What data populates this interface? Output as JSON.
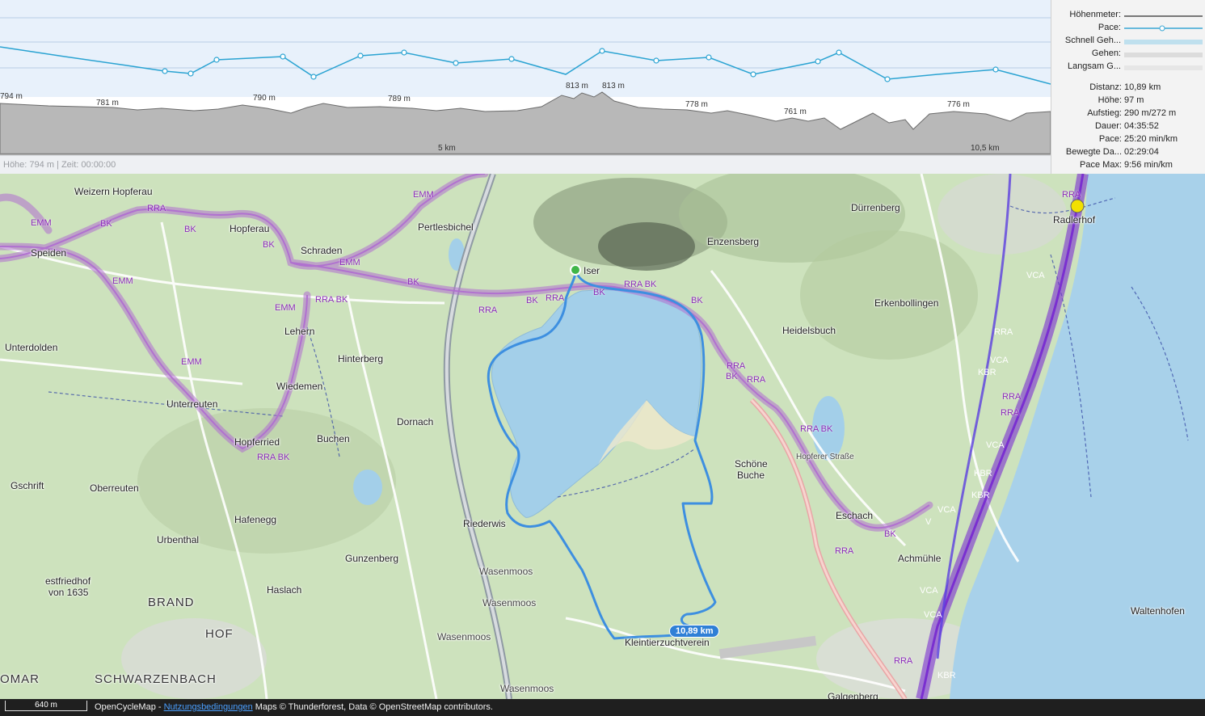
{
  "profile": {
    "status": "Höhe: 794 m | Zeit: 00:00:00",
    "elevation_labels": [
      "794 m",
      "781 m",
      "790 m",
      "789 m",
      "813 m",
      "813 m",
      "778 m",
      "761 m",
      "776 m"
    ],
    "distance_ticks": [
      "5 km",
      "10,5 km"
    ]
  },
  "legend": {
    "items": [
      {
        "name": "Höhenmeter:",
        "color": "#777777"
      },
      {
        "name": "Pace:",
        "color": "#3aa7d4"
      },
      {
        "name": "Schnell Geh...",
        "color": "#bfe0ee"
      },
      {
        "name": "Gehen:",
        "color": "#dcdcdc"
      },
      {
        "name": "Langsam G...",
        "color": "#e6e6e6"
      }
    ],
    "stats": [
      {
        "key": "Distanz:",
        "value": "10,89 km"
      },
      {
        "key": "Höhe:",
        "value": "97 m"
      },
      {
        "key": "Aufstieg:",
        "value": "290 m/272 m"
      },
      {
        "key": "Dauer:",
        "value": "04:35:52"
      },
      {
        "key": "Pace:",
        "value": "25:20 min/km"
      },
      {
        "key": "Bewegte Da...",
        "value": "02:29:04"
      },
      {
        "key": "Pace Max:",
        "value": "9:56 min/km"
      }
    ]
  },
  "map": {
    "colors": {
      "water": "#a3cfe9",
      "land": "#cfe3c0",
      "route": "#3d8fe0",
      "cycle_route": "#b06fd0",
      "major_cycle": "#7a2fd0"
    },
    "places": [
      "Weizern Hopferau",
      "Hopferau",
      "Speiden",
      "Schraden",
      "Pertlesbichel",
      "Enzensberg",
      "Dürrenberg",
      "Radlerhof",
      "Lehern",
      "Hinterberg",
      "Unterdolden",
      "Erkenbollingen",
      "Heidelsbuch",
      "Wiedemen",
      "Unterreuten",
      "Dornach",
      "Hopferried",
      "Buchen",
      "Schöne",
      "Buche",
      "Gschrift",
      "Oberreuten",
      "Hafenegg",
      "Eschach",
      "Urbenthal",
      "Riederwis",
      "Gunzenberg",
      "Achmühle",
      "Wasenmoos",
      "Wasenmoos",
      "Haslach",
      "estfriedhof",
      "von 1635",
      "BRAND",
      "Waltenhofen",
      "Wasenmoos",
      "HOF",
      "Kleintierzuchtverein",
      "OMAR",
      "SCHWARZENBACH",
      "Wasenmoos",
      "Galgenberg",
      "Iser"
    ],
    "route_labels": [
      "RRA",
      "BK",
      "EMM",
      "EMM",
      "BK",
      "RRA",
      "BK",
      "EMM",
      "RRA BK",
      "RRA",
      "BK",
      "RRA",
      "BK",
      "RRA BK",
      "BK",
      "BK",
      "RRA",
      "EMM",
      "EMM",
      "EMM",
      "RRA BK",
      "RRA",
      "BK",
      "RRA",
      "Hopferer Straße",
      "RRA",
      "BK",
      "VCA",
      "VCA",
      "KBR",
      "RRA",
      "VCA",
      "KBR",
      "VCA",
      "RRA",
      "KBR",
      "VCA",
      "V",
      "RRA BK",
      "VCA",
      "KBR",
      "RRA"
    ],
    "distance_badge": "10,89 km"
  },
  "footer": {
    "scale": "640 m",
    "brand": "OpenCycleMap - ",
    "link": "Nutzungsbedingungen",
    "attribution": " Maps © Thunderforest, Data © OpenStreetMap contributors."
  }
}
